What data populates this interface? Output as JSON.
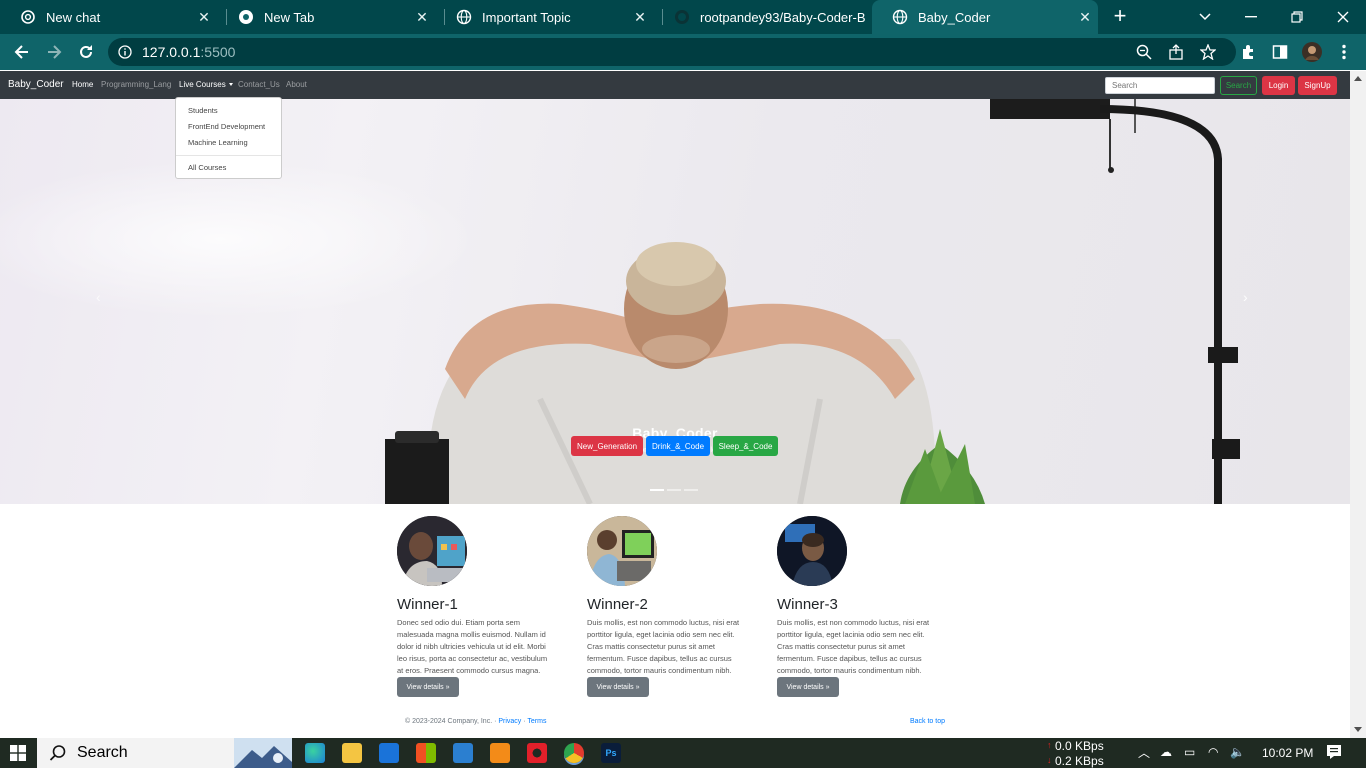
{
  "browser": {
    "tabs": [
      {
        "title": "New chat",
        "icon": "chatgpt-icon"
      },
      {
        "title": "New Tab",
        "icon": "chrome-icon"
      },
      {
        "title": "Important Topic",
        "icon": "globe-icon"
      },
      {
        "title": "rootpandey93/Baby-Coder-B",
        "icon": "github-icon"
      },
      {
        "title": "Baby_Coder",
        "icon": "globe-icon",
        "active": true
      }
    ],
    "url_host": "127.0.0.1",
    "url_port": ":5500"
  },
  "nav": {
    "brand": "Baby_Coder",
    "links": [
      "Home",
      "Programming_Lang",
      "Live Courses",
      "Contact_Us",
      "About"
    ],
    "search_placeholder": "Search",
    "search_button": "Search",
    "login": "Login",
    "signup": "SignUp",
    "dropdown": [
      "Students",
      "FrontEnd Development",
      "Machine Learning",
      "All Courses"
    ]
  },
  "hero": {
    "title": "Baby_Coder",
    "subtitle": "New_Generation, Drink_&_Code, Sleep_&_Code.",
    "buttons": [
      "New_Generation",
      "Drink_&_Code",
      "Sleep_&_Code"
    ],
    "colors": {
      "red": "#dc3545",
      "blue": "#007bff",
      "green": "#28a745"
    }
  },
  "winners": [
    {
      "title": "Winner-1",
      "text": "Donec sed odio dui. Etiam porta sem malesuada magna mollis euismod. Nullam id dolor id nibh ultricies vehicula ut id elit. Morbi leo risus, porta ac consectetur ac, vestibulum at eros. Praesent commodo cursus magna.",
      "button": "View details »"
    },
    {
      "title": "Winner-2",
      "text": "Duis mollis, est non commodo luctus, nisi erat porttitor ligula, eget lacinia odio sem nec elit. Cras mattis consectetur purus sit amet fermentum. Fusce dapibus, tellus ac cursus commodo, tortor mauris condimentum nibh.",
      "button": "View details »"
    },
    {
      "title": "Winner-3",
      "text": "Duis mollis, est non commodo luctus, nisi erat porttitor ligula, eget lacinia odio sem nec elit. Cras mattis consectetur purus sit amet fermentum. Fusce dapibus, tellus ac cursus commodo, tortor mauris condimentum nibh.",
      "button": "View details »"
    }
  ],
  "footer": {
    "copyright": "© 2023-2024 Company, Inc. · ",
    "privacy": "Privacy",
    "dot": " · ",
    "terms": "Terms",
    "back_to_top": "Back to top"
  },
  "taskbar": {
    "search": "Search",
    "net_up": "0.0 KBps",
    "net_down": "0.2 KBps",
    "time": "10:02 PM"
  }
}
